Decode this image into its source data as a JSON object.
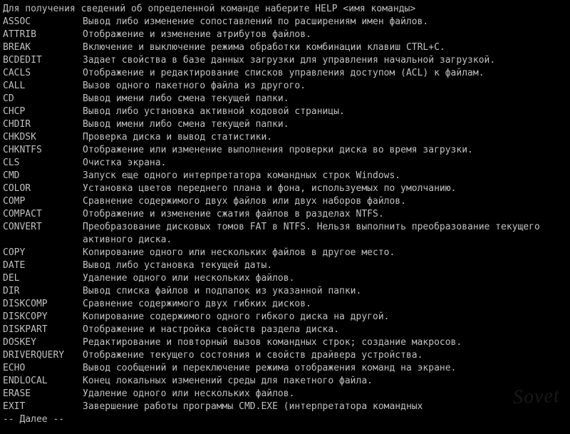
{
  "intro": "Для получения сведений об определенной команде наберите HELP <имя команды>",
  "commands": [
    {
      "name": "ASSOC",
      "desc": "Вывод либо изменение сопоставлений по расширениям имен файлов."
    },
    {
      "name": "ATTRIB",
      "desc": "Отображение и изменение атрибутов файлов."
    },
    {
      "name": "BREAK",
      "desc": "Включение и выключение режима обработки комбинации клавиш CTRL+C."
    },
    {
      "name": "BCDEDIT",
      "desc": "Задает свойства в базе данных загрузки для управления начальной загрузкой."
    },
    {
      "name": "CACLS",
      "desc": "Отображение и редактирование списков управления доступом (ACL) к файлам."
    },
    {
      "name": "CALL",
      "desc": "Вызов одного пакетного файла из другого."
    },
    {
      "name": "CD",
      "desc": "Вывод имени либо смена текущей папки."
    },
    {
      "name": "CHCP",
      "desc": "Вывод либо установка активной кодовой страницы."
    },
    {
      "name": "CHDIR",
      "desc": "Вывод имени либо смена текущей папки."
    },
    {
      "name": "CHKDSK",
      "desc": "Проверка диска и вывод статистики."
    },
    {
      "name": "CHKNTFS",
      "desc": "Отображение или изменение выполнения проверки диска во время загрузки."
    },
    {
      "name": "CLS",
      "desc": "Очистка экрана."
    },
    {
      "name": "CMD",
      "desc": "Запуск еще одного интерпретатора командных строк Windows."
    },
    {
      "name": "COLOR",
      "desc": "Установка цветов переднего плана и фона, используемых по умолчанию."
    },
    {
      "name": "COMP",
      "desc": "Сравнение содержимого двух файлов или двух наборов файлов."
    },
    {
      "name": "COMPACT",
      "desc": "Отображение и изменение сжатия файлов в разделах NTFS."
    },
    {
      "name": "CONVERT",
      "desc": "Преобразование дисковых томов FAT в NTFS. Нельзя выполнить преобразование текущего активного диска."
    },
    {
      "name": "COPY",
      "desc": "Копирование одного или нескольких файлов в другое место."
    },
    {
      "name": "DATE",
      "desc": "Вывод либо установка текущей даты."
    },
    {
      "name": "DEL",
      "desc": "Удаление одного или нескольких файлов."
    },
    {
      "name": "DIR",
      "desc": "Вывод списка файлов и подпапок из указанной папки."
    },
    {
      "name": "DISKCOMP",
      "desc": "Сравнение содержимого двух гибких дисков."
    },
    {
      "name": "DISKCOPY",
      "desc": "Копирование содержимого одного гибкого диска на другой."
    },
    {
      "name": "DISKPART",
      "desc": "Отображение и настройка свойств раздела диска."
    },
    {
      "name": "DOSKEY",
      "desc": "Редактирование и повторный вызов командных строк; создание макросов."
    },
    {
      "name": "DRIVERQUERY",
      "desc": "Отображение текущего состояния и свойств драйвера устройства."
    },
    {
      "name": "ECHO",
      "desc": "Вывод сообщений и переключение режима отображения команд на экране."
    },
    {
      "name": "ENDLOCAL",
      "desc": "Конец локальных изменений среды для пакетного файла."
    },
    {
      "name": "ERASE",
      "desc": "Удаление одного или нескольких файлов."
    },
    {
      "name": "EXIT",
      "desc": "Завершение работы программы CMD.EXE (интерпретатора командных"
    }
  ],
  "more": "-- Далее  --",
  "watermark": "Sovet"
}
